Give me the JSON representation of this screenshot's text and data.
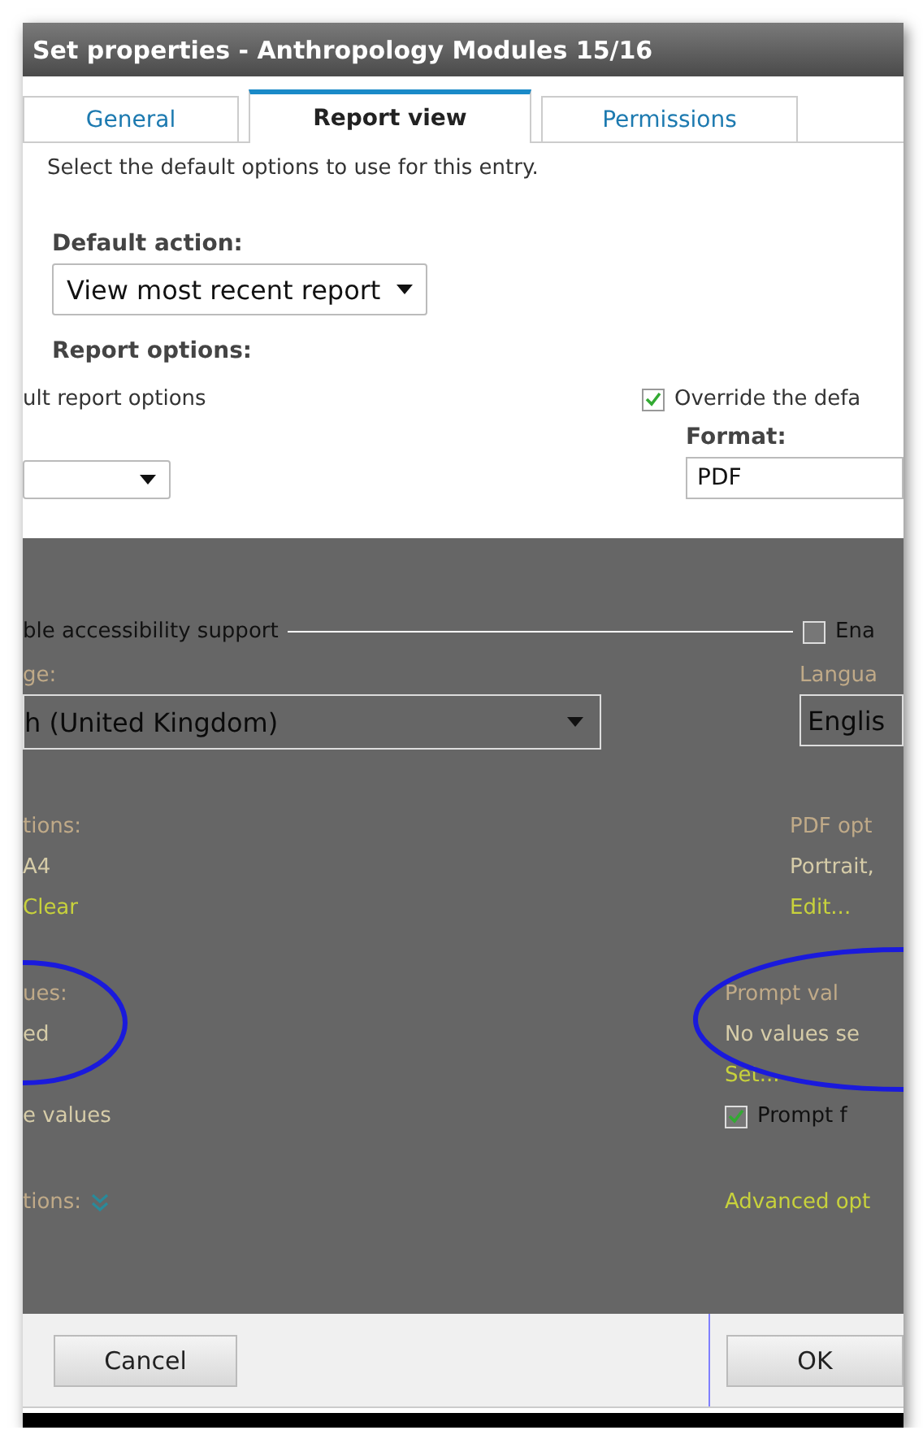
{
  "window": {
    "title": "Set properties - Anthropology Modules 15/16"
  },
  "tabs": [
    {
      "label": "General",
      "selected": false
    },
    {
      "label": "Report view",
      "selected": true
    },
    {
      "label": "Permissions",
      "selected": false
    }
  ],
  "intro": "Select the default options to use for this entry.",
  "default_action": {
    "label": "Default action:",
    "value": "View most recent report"
  },
  "report_options": {
    "heading": "Report options:",
    "left_option": "ult report options",
    "override": {
      "label": "Override the defa",
      "checked": true
    },
    "format": {
      "label": "Format:",
      "value": "PDF"
    }
  },
  "overlay_panel": {
    "accessibility": {
      "label": "ble accessibility support",
      "checkbox_label": "Ena",
      "checked": false
    },
    "left_language": {
      "label": "ge:",
      "value": "h (United Kingdom)"
    },
    "right_language": {
      "label": "Langua",
      "value": "Englis"
    },
    "sections": [
      {
        "rows": [
          {
            "left": {
              "kind": "label",
              "text": "tions:"
            },
            "right": {
              "kind": "label",
              "text": "PDF opt"
            }
          },
          {
            "left": {
              "kind": "text",
              "text": "A4"
            },
            "right": {
              "kind": "text",
              "text": "Portrait,"
            }
          },
          {
            "left": {
              "kind": "link",
              "text": "Clear"
            },
            "right": {
              "kind": "link",
              "text": "Edit..."
            }
          }
        ]
      },
      {
        "rows": [
          {
            "left": {
              "kind": "label",
              "text": "ues:"
            },
            "right": {
              "kind": "label",
              "text": "Prompt val"
            }
          },
          {
            "left": {
              "kind": "text",
              "text": "ed"
            },
            "right": {
              "kind": "text",
              "text": "No values se"
            }
          },
          {
            "left": {
              "kind": "none"
            },
            "right": {
              "kind": "link",
              "text": "Set..."
            }
          },
          {
            "left": {
              "kind": "text",
              "text": "e values"
            },
            "right": {
              "kind": "checkbox",
              "text": "Prompt f",
              "checked": true
            }
          }
        ]
      },
      {
        "rows": [
          {
            "left": {
              "kind": "expander",
              "text": "tions:"
            },
            "right": {
              "kind": "link",
              "text": "Advanced opt"
            }
          }
        ]
      }
    ]
  },
  "footer": {
    "buttons": [
      {
        "label": "Cancel"
      },
      {
        "label": "OK"
      }
    ]
  }
}
